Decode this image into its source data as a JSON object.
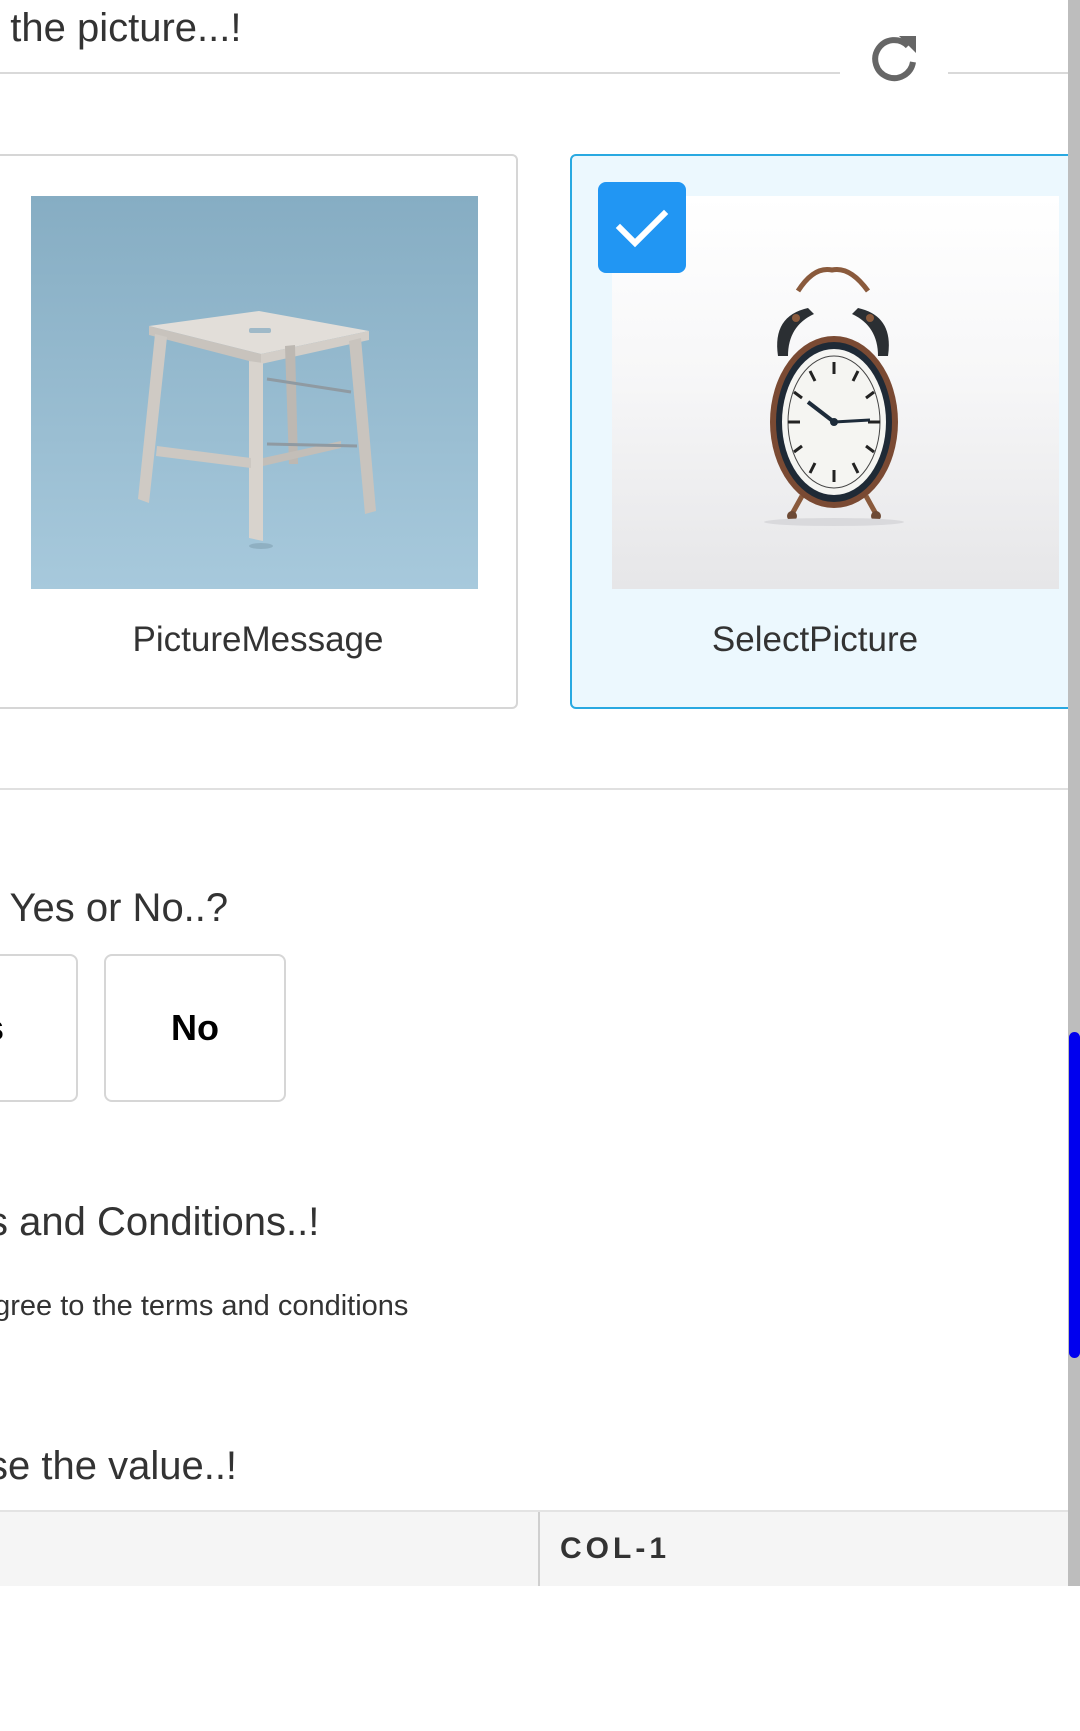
{
  "question_picture": {
    "title": "t the picture...!",
    "refresh_icon": "refresh-icon",
    "options": [
      {
        "caption": "PictureMessage",
        "selected": false,
        "image": "wooden-stool-photo"
      },
      {
        "caption": "SelectPicture",
        "selected": true,
        "image": "alarm-clock-photo"
      }
    ],
    "selected_color": "#2196f3",
    "selected_border_color": "#29a9e1"
  },
  "question_yes_no": {
    "title": "t Yes or No..?",
    "yes_label": "s",
    "no_label": "No"
  },
  "question_terms": {
    "title": "s and Conditions..!",
    "checkbox_label": "agree to the terms and conditions"
  },
  "question_matrix": {
    "title": "se the value..!",
    "columns": [
      "",
      "COL-1"
    ]
  },
  "scrollbar_color": "#0000ee"
}
